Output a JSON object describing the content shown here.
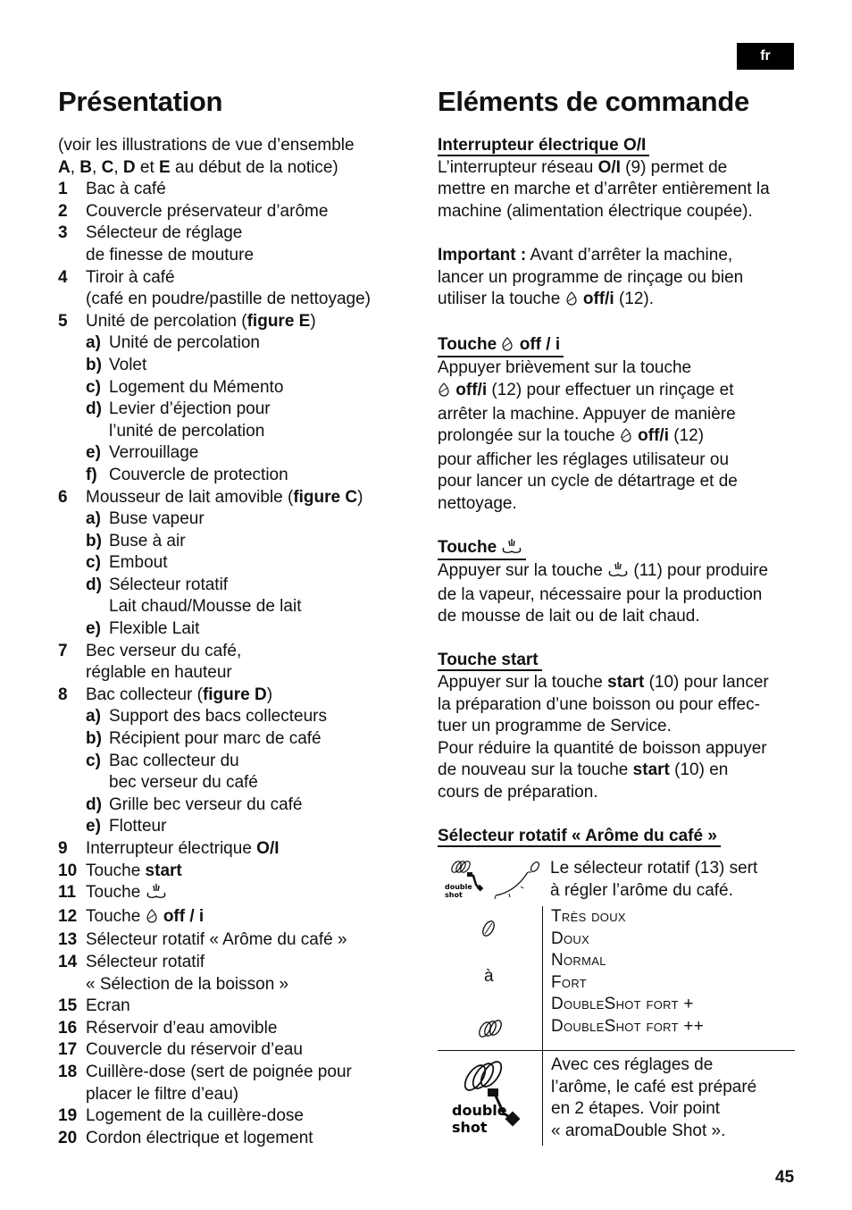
{
  "lang_badge": "fr",
  "page_number": "45",
  "left": {
    "title": "Présentation",
    "intro_line1": "(voir les illustrations de vue d’ensemble",
    "intro_line2": {
      "A": "A",
      "sep1": ", ",
      "B": "B",
      "sep2": ", ",
      "C": "C",
      "sep3": ", ",
      "D": "D",
      "et": " et ",
      "E": "E",
      "rest": " au début de la notice)"
    },
    "items": [
      {
        "num": "1",
        "lines": [
          "Bac à café"
        ]
      },
      {
        "num": "2",
        "lines": [
          "Couvercle préservateur d’arôme"
        ]
      },
      {
        "num": "3",
        "lines": [
          "Sélecteur de réglage",
          "de finesse de mouture"
        ]
      },
      {
        "num": "4",
        "lines": [
          "Tiroir à café",
          "(café en poudre/pastille de nettoyage)"
        ]
      },
      {
        "num": "5",
        "text": "Unité de percolation (",
        "bold": "figure E",
        "close": ")",
        "subs": [
          {
            "let": "a)",
            "lines": [
              "Unité de percolation"
            ]
          },
          {
            "let": "b)",
            "lines": [
              "Volet"
            ]
          },
          {
            "let": "c)",
            "lines": [
              "Logement du Mémento"
            ]
          },
          {
            "let": "d)",
            "lines": [
              "Levier d’éjection pour",
              "l’unité de percolation"
            ]
          },
          {
            "let": "e)",
            "lines": [
              "Verrouillage"
            ]
          },
          {
            "let": "f)",
            "lines": [
              "Couvercle de protection"
            ]
          }
        ]
      },
      {
        "num": "6",
        "text": "Mousseur de lait amovible (",
        "bold": "figure C",
        "close": ")",
        "subs": [
          {
            "let": "a)",
            "lines": [
              "Buse vapeur"
            ]
          },
          {
            "let": "b)",
            "lines": [
              "Buse à air"
            ]
          },
          {
            "let": "c)",
            "lines": [
              "Embout"
            ]
          },
          {
            "let": "d)",
            "lines": [
              "Sélecteur rotatif",
              "Lait chaud/Mousse de lait"
            ]
          },
          {
            "let": "e)",
            "lines": [
              "Flexible Lait"
            ]
          }
        ]
      },
      {
        "num": "7",
        "lines": [
          "Bec verseur du café,",
          "réglable en hauteur"
        ]
      },
      {
        "num": "8",
        "text": "Bac collecteur (",
        "bold": "figure D",
        "close": ")",
        "subs": [
          {
            "let": "a)",
            "lines": [
              "Support des bacs collecteurs"
            ]
          },
          {
            "let": "b)",
            "lines": [
              "Récipient pour marc de café"
            ]
          },
          {
            "let": "c)",
            "lines": [
              "Bac collecteur du",
              "bec verseur du café"
            ]
          },
          {
            "let": "d)",
            "lines": [
              "Grille bec verseur du café"
            ]
          },
          {
            "let": "e)",
            "lines": [
              "Flotteur"
            ]
          }
        ]
      },
      {
        "num": "9",
        "text": "Interrupteur électrique ",
        "bold": "O/I"
      },
      {
        "num": "10",
        "text": "Touche ",
        "bold": "start"
      },
      {
        "num": "11",
        "text": "Touche ",
        "icon": "steam-icon"
      },
      {
        "num": "12",
        "text": "Touche ",
        "icon": "rinse-drop-icon",
        "bold": "off / i"
      },
      {
        "num": "13",
        "lines": [
          "Sélecteur rotatif « Arôme du café »"
        ]
      },
      {
        "num": "14",
        "lines": [
          "Sélecteur rotatif",
          "« Sélection de la boisson »"
        ]
      },
      {
        "num": "15",
        "lines": [
          "Ecran"
        ]
      },
      {
        "num": "16",
        "lines": [
          "Réservoir d’eau amovible"
        ]
      },
      {
        "num": "17",
        "lines": [
          "Couvercle du réservoir d’eau"
        ]
      },
      {
        "num": "18",
        "lines": [
          "Cuillère-dose (sert de poignée pour",
          "placer le filtre d’eau)"
        ]
      },
      {
        "num": "19",
        "lines": [
          "Logement de la cuillère-dose"
        ]
      },
      {
        "num": "20",
        "lines": [
          "Cordon électrique et logement"
        ]
      }
    ]
  },
  "right": {
    "title": "Eléments de commande",
    "s1": {
      "title": "Interrupteur électrique O/I",
      "p1_a": "L’interrupteur réseau ",
      "p1_b": "O/I",
      "p1_c": " (9) permet de",
      "p1_l2": "mettre en marche et d’arrêter entièrement la",
      "p1_l3": "machine (alimentation électrique coupée).",
      "imp_label": "Important :",
      "imp_l1": " Avant d’arrêter la machine,",
      "imp_l2": "lancer un programme de rinçage ou bien",
      "imp_l3a": "utiliser la touche ",
      "imp_l3b": "off/i",
      "imp_l3c": " (12)."
    },
    "s2": {
      "title_a": "Touche ",
      "title_b": "off / i",
      "l1": "Appuyer brièvement sur la touche",
      "l2b": "off/i",
      "l2c": " (12) pour effectuer un rinçage et",
      "l3": "arrêter la machine. Appuyer de manière",
      "l4a": "prolongée sur la touche ",
      "l4b": "off/i",
      "l4c": " (12)",
      "l5": "pour afficher les réglages utilisateur ou",
      "l6": "pour lancer un cycle de détartrage et de",
      "l7": "nettoyage."
    },
    "s3": {
      "title": "Touche ",
      "l1a": "Appuyer sur la touche ",
      "l1c": " (11) pour produire",
      "l2": "de la vapeur, nécessaire pour la production",
      "l3": "de mousse de lait ou de lait chaud."
    },
    "s4": {
      "title": "Touche start",
      "l1a": "Appuyer sur la touche ",
      "l1b": "start",
      "l1c": " (10) pour lancer",
      "l2": "la préparation d’une boisson ou pour effec-",
      "l3": "tuer un programme de Service.",
      "l4": "Pour réduire la quantité de boisson appuyer",
      "l5a": "de nouveau sur la touche ",
      "l5b": "start",
      "l5c": " (10) en",
      "l6": "cours de préparation."
    },
    "s5": {
      "title": "Sélecteur rotatif « Arôme du café »",
      "intro_l1": "Le sélecteur rotatif (13) sert",
      "intro_l2": "à régler l’arôme du café.",
      "dial_label_1": "double",
      "dial_label_2": "shot",
      "range_word": "à",
      "levels": [
        "Très doux",
        "Doux",
        "Normal",
        "Fort",
        "DoubleShot fort +",
        "DoubleShot fort ++"
      ],
      "ds_label_1": "double",
      "ds_label_2": "shot",
      "ds_text": [
        "Avec ces réglages de",
        "l’arôme, le café est préparé",
        "en 2 étapes. Voir point",
        "« aromaDouble Shot »."
      ]
    }
  }
}
